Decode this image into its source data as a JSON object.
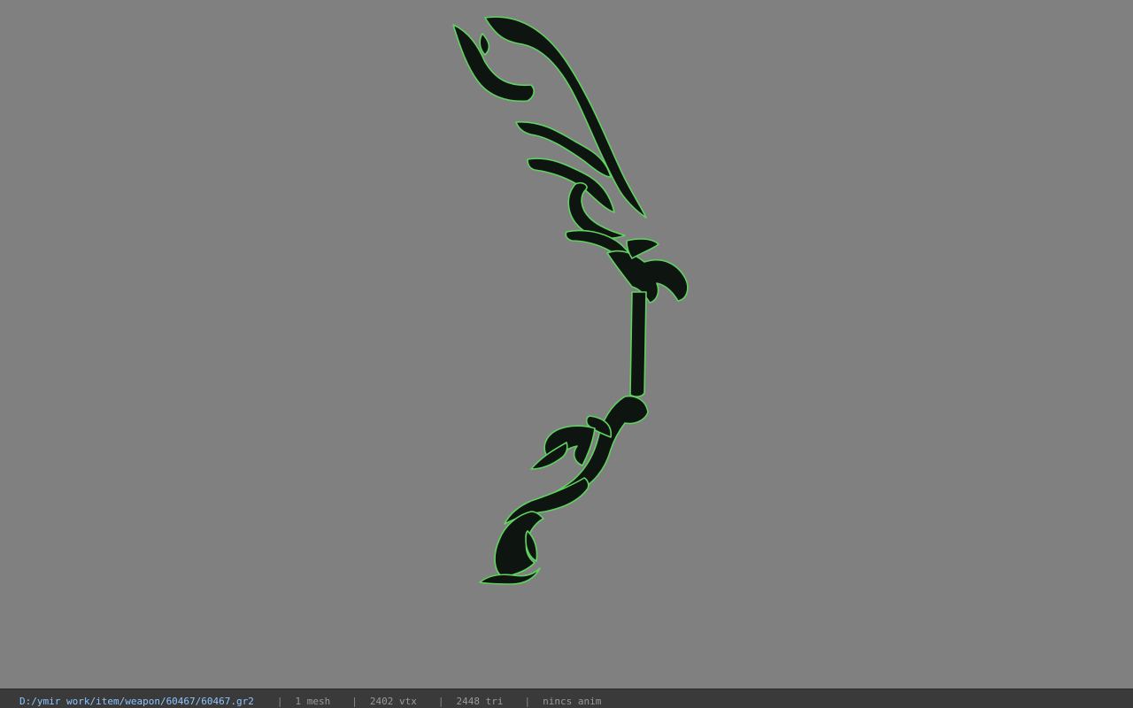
{
  "viewer": {
    "background_color": "#808080",
    "model_color": "#0e1410",
    "edge_highlight_color": "#5fd35f"
  },
  "status_bar": {
    "file_path": "D:/ymir work/item/weapon/60467/60467.gr2",
    "separator": "|",
    "mesh_count": "1 mesh",
    "vertex_count": "2402 vtx",
    "triangle_count": "2448 tri",
    "animation": "nincs anim"
  }
}
